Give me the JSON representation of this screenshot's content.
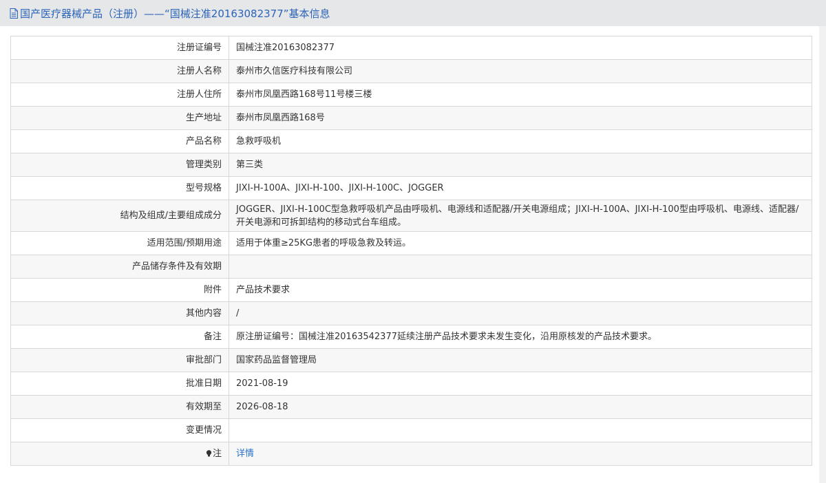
{
  "header": {
    "title": "国产医疗器械产品（注册）——“国械注准20163082377”基本信息",
    "icon": "document-icon"
  },
  "rows": [
    {
      "label": "注册证编号",
      "value": "国械注准20163082377"
    },
    {
      "label": "注册人名称",
      "value": "泰州市久信医疗科技有限公司"
    },
    {
      "label": "注册人住所",
      "value": "泰州市凤凰西路168号11号楼三楼"
    },
    {
      "label": "生产地址",
      "value": "泰州市凤凰西路168号"
    },
    {
      "label": "产品名称",
      "value": "急救呼吸机"
    },
    {
      "label": "管理类别",
      "value": "第三类"
    },
    {
      "label": "型号规格",
      "value": "JIXI-H-100A、JIXI-H-100、JIXI-H-100C、JOGGER"
    },
    {
      "label": "结构及组成/主要组成成分",
      "value": "JOGGER、JIXI-H-100C型急救呼吸机产品由呼吸机、电源线和适配器/开关电源组成；JIXI-H-100A、JIXI-H-100型由呼吸机、电源线、适配器/开关电源和可拆卸结构的移动式台车组成。"
    },
    {
      "label": "适用范围/预期用途",
      "value": "适用于体重≥25KG患者的呼吸急救及转运。"
    },
    {
      "label": "产品储存条件及有效期",
      "value": ""
    },
    {
      "label": "附件",
      "value": "产品技术要求"
    },
    {
      "label": "其他内容",
      "value": "/"
    },
    {
      "label": "备注",
      "value": "原注册证编号：国械注准20163542377延续注册产品技术要求未发生变化，沿用原核发的产品技术要求。"
    },
    {
      "label": "审批部门",
      "value": "国家药品监督管理局"
    },
    {
      "label": "批准日期",
      "value": "2021-08-19"
    },
    {
      "label": "有效期至",
      "value": "2026-08-18"
    },
    {
      "label": "变更情况",
      "value": ""
    },
    {
      "label": "注",
      "value": "详情",
      "icon": "bulb-icon"
    }
  ],
  "colors": {
    "title": "#2a63b8",
    "link": "#2a72c9",
    "border": "#d7d7d7"
  }
}
